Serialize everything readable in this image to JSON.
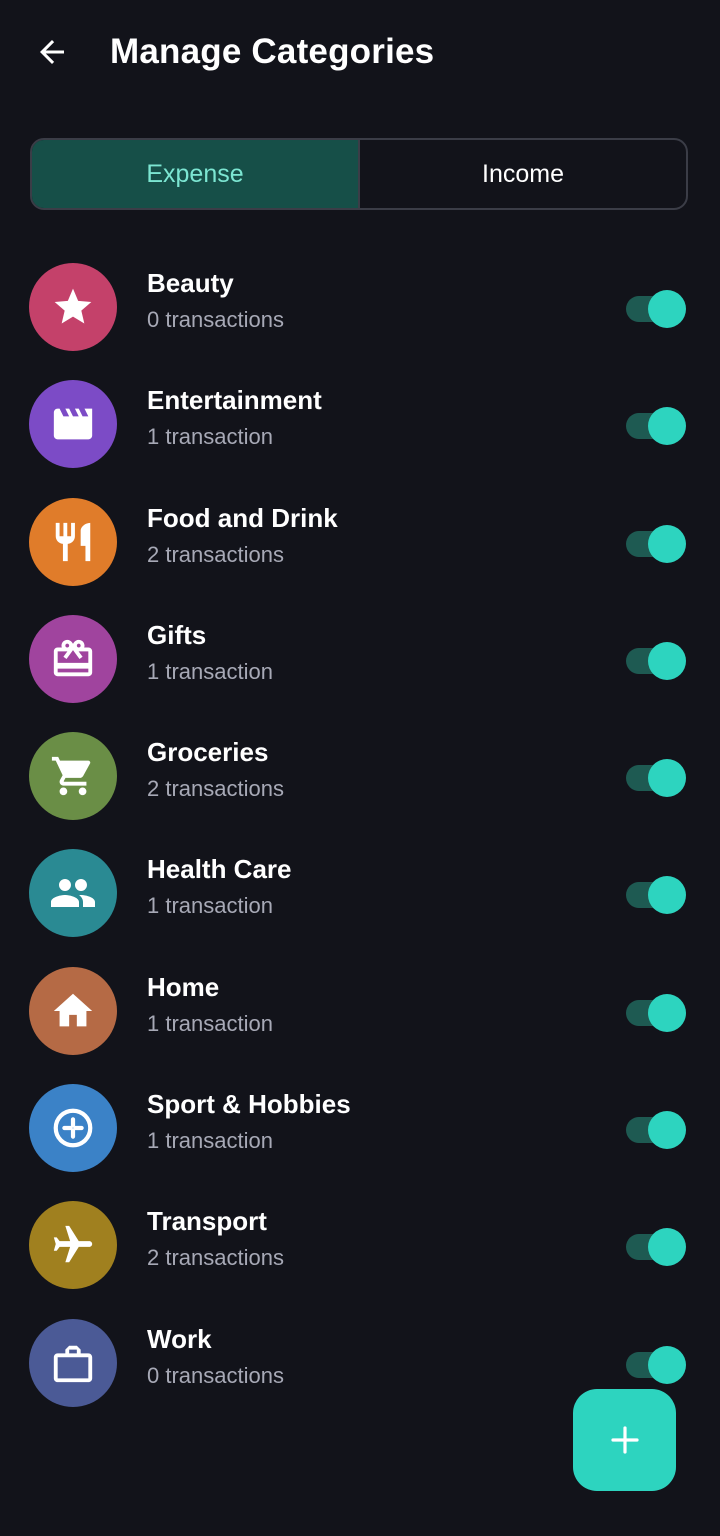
{
  "header": {
    "title": "Manage Categories",
    "back_icon": "arrow-left-icon"
  },
  "tabs": [
    {
      "label": "Expense",
      "active": true
    },
    {
      "label": "Income",
      "active": false
    }
  ],
  "colors": {
    "background": "#12131a",
    "accent": "#2dd4bf",
    "active_tab_bg": "#164f48",
    "active_tab_text": "#7ce6d2",
    "secondary_text": "#a7a9b6"
  },
  "categories": [
    {
      "name": "Beauty",
      "count": "0 transactions",
      "icon": "star-icon",
      "color": "#c4416a",
      "enabled": true
    },
    {
      "name": "Entertainment",
      "count": "1 transaction",
      "icon": "clapperboard-icon",
      "color": "#7c4bc6",
      "enabled": true
    },
    {
      "name": "Food and Drink",
      "count": "2 transactions",
      "icon": "restaurant-icon",
      "color": "#e07c2a",
      "enabled": true
    },
    {
      "name": "Gifts",
      "count": "1 transaction",
      "icon": "gift-card-icon",
      "color": "#a0449e",
      "enabled": true
    },
    {
      "name": "Groceries",
      "count": "2 transactions",
      "icon": "shopping-cart-icon",
      "color": "#6a8e46",
      "enabled": true
    },
    {
      "name": "Health Care",
      "count": "1 transaction",
      "icon": "people-icon",
      "color": "#2a8a93",
      "enabled": true
    },
    {
      "name": "Home",
      "count": "1 transaction",
      "icon": "home-icon",
      "color": "#b56a45",
      "enabled": true
    },
    {
      "name": "Sport & Hobbies",
      "count": "1 transaction",
      "icon": "crosshair-icon",
      "color": "#3b82c7",
      "enabled": true
    },
    {
      "name": "Transport",
      "count": "2 transactions",
      "icon": "airplane-icon",
      "color": "#a0801f",
      "enabled": true
    },
    {
      "name": "Work",
      "count": "0 transactions",
      "icon": "briefcase-icon",
      "color": "#4b5a96",
      "enabled": true
    }
  ],
  "fab": {
    "icon": "plus-icon"
  }
}
